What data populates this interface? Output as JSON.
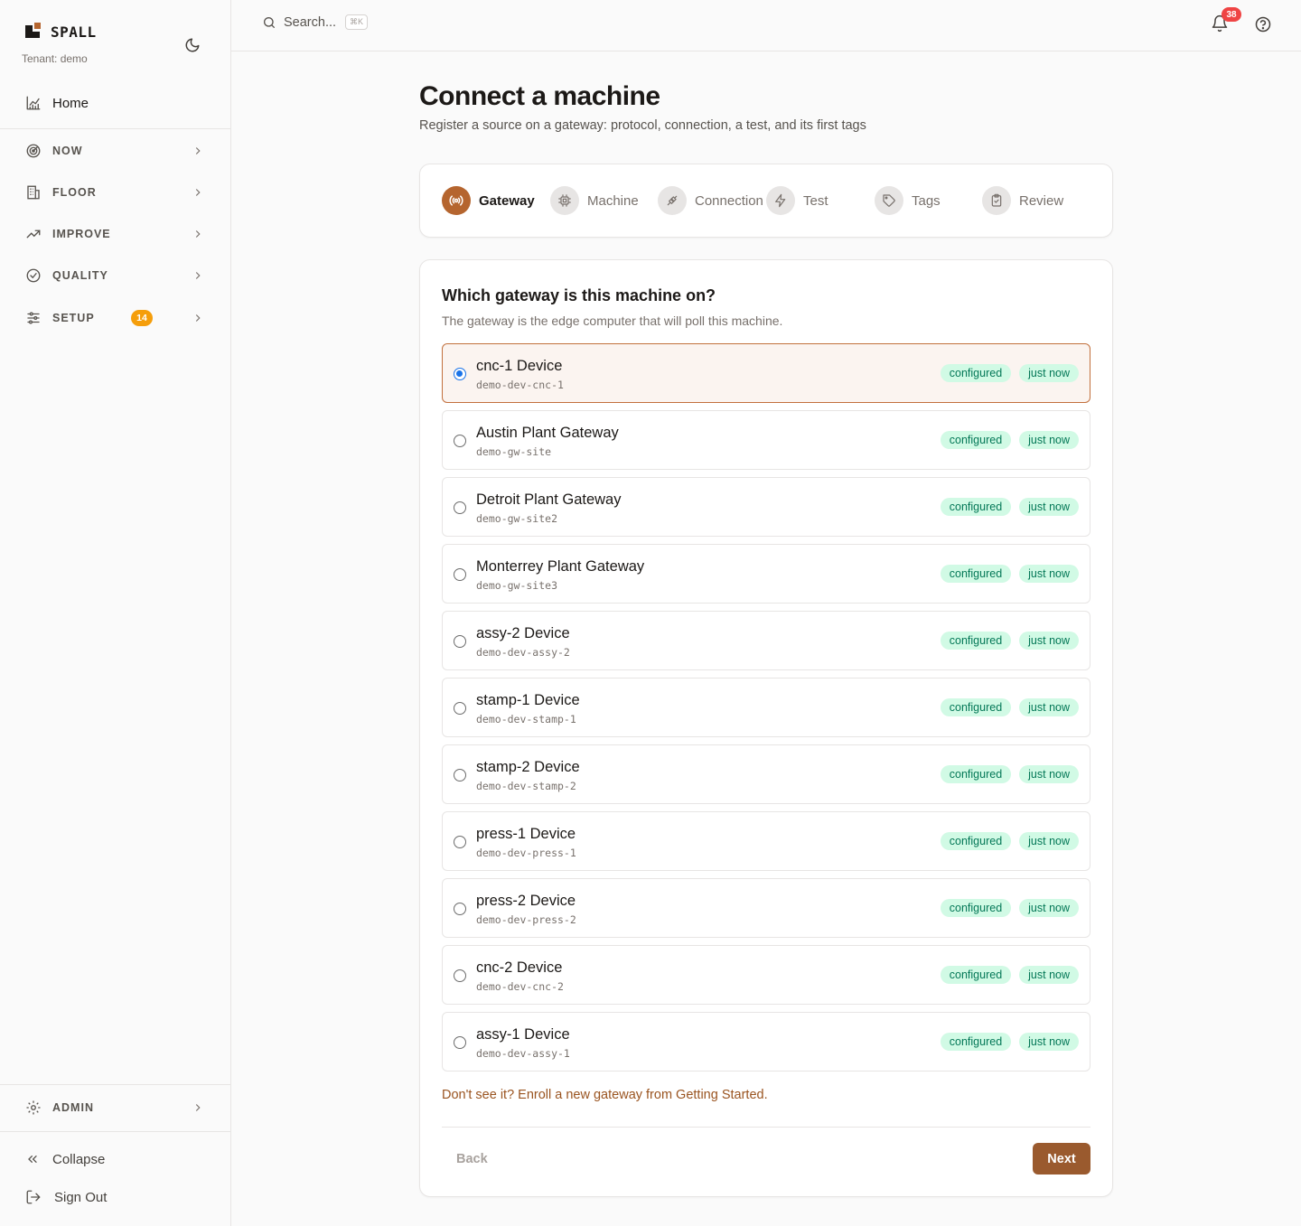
{
  "brand": {
    "name": "SPALL",
    "tenant": "Tenant: demo"
  },
  "sidebar": {
    "home": "Home",
    "groups": [
      {
        "label": "NOW",
        "icon": "radar-icon"
      },
      {
        "label": "FLOOR",
        "icon": "building-icon"
      },
      {
        "label": "IMPROVE",
        "icon": "trending-up-icon"
      },
      {
        "label": "QUALITY",
        "icon": "check-circle-icon"
      },
      {
        "label": "SETUP",
        "icon": "sliders-icon",
        "badge": "14"
      }
    ],
    "admin": "ADMIN",
    "collapse": "Collapse",
    "signout": "Sign Out"
  },
  "topbar": {
    "search_placeholder": "Search...",
    "shortcut": "⌘K",
    "notification_count": "38"
  },
  "page": {
    "title": "Connect a machine",
    "subtitle": "Register a source on a gateway: protocol, connection, a test, and its first tags"
  },
  "steps": [
    {
      "label": "Gateway",
      "active": true
    },
    {
      "label": "Machine"
    },
    {
      "label": "Connection"
    },
    {
      "label": "Test"
    },
    {
      "label": "Tags"
    },
    {
      "label": "Review"
    }
  ],
  "form": {
    "title": "Which gateway is this machine on?",
    "subtitle": "The gateway is the edge computer that will poll this machine.",
    "options": [
      {
        "name": "cnc-1 Device",
        "id": "demo-dev-cnc-1",
        "status": "configured",
        "seen": "just now",
        "selected": true
      },
      {
        "name": "Austin Plant Gateway",
        "id": "demo-gw-site",
        "status": "configured",
        "seen": "just now"
      },
      {
        "name": "Detroit Plant Gateway",
        "id": "demo-gw-site2",
        "status": "configured",
        "seen": "just now"
      },
      {
        "name": "Monterrey Plant Gateway",
        "id": "demo-gw-site3",
        "status": "configured",
        "seen": "just now"
      },
      {
        "name": "assy-2 Device",
        "id": "demo-dev-assy-2",
        "status": "configured",
        "seen": "just now"
      },
      {
        "name": "stamp-1 Device",
        "id": "demo-dev-stamp-1",
        "status": "configured",
        "seen": "just now"
      },
      {
        "name": "stamp-2 Device",
        "id": "demo-dev-stamp-2",
        "status": "configured",
        "seen": "just now"
      },
      {
        "name": "press-1 Device",
        "id": "demo-dev-press-1",
        "status": "configured",
        "seen": "just now"
      },
      {
        "name": "press-2 Device",
        "id": "demo-dev-press-2",
        "status": "configured",
        "seen": "just now"
      },
      {
        "name": "cnc-2 Device",
        "id": "demo-dev-cnc-2",
        "status": "configured",
        "seen": "just now"
      },
      {
        "name": "assy-1 Device",
        "id": "demo-dev-assy-1",
        "status": "configured",
        "seen": "just now"
      }
    ],
    "enroll_link": "Don't see it? Enroll a new gateway from Getting Started.",
    "back_label": "Back",
    "next_label": "Next"
  },
  "colors": {
    "accent": "#b5652f",
    "primary_button": "#9a5a2e",
    "pill_bg": "#d1fae5",
    "pill_text": "#047857",
    "badge": "#f59e0b",
    "alert": "#ef4444"
  }
}
